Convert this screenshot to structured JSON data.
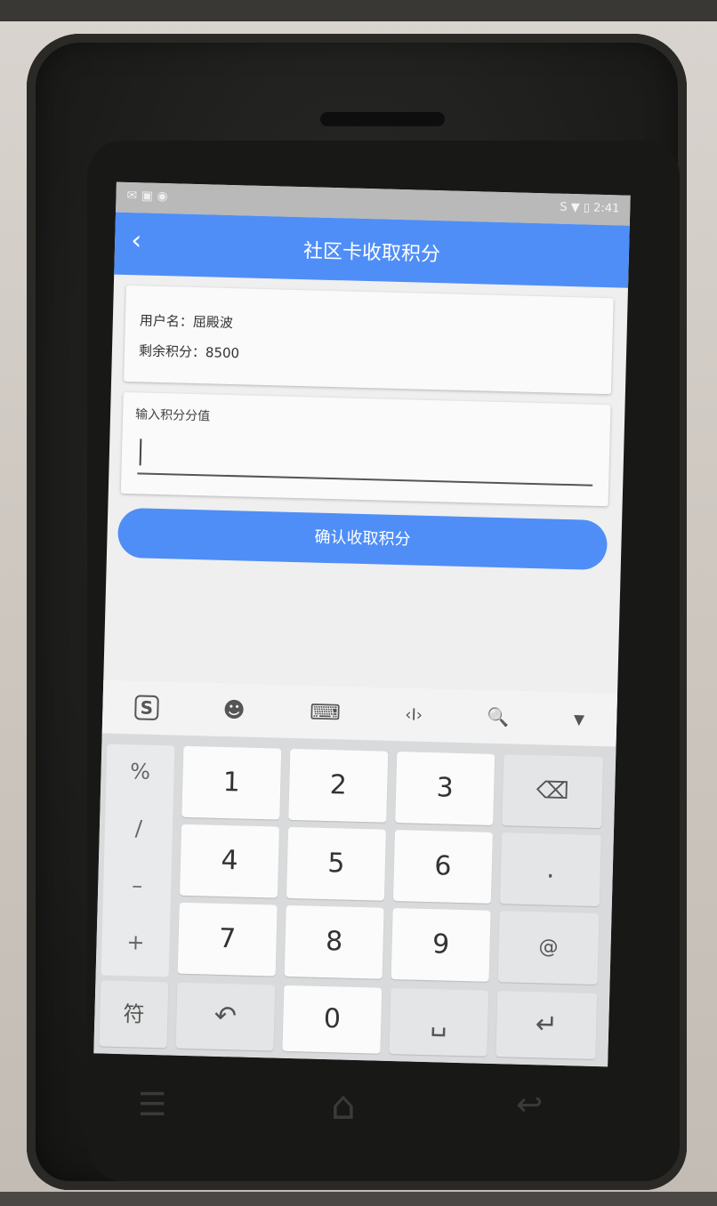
{
  "status_bar": {
    "left_icons": "✉ ▣ ◉",
    "right_icons": "S ▼ ▯",
    "time": "2:41"
  },
  "app_bar": {
    "back_icon": "‹",
    "title": "社区卡收取积分"
  },
  "user_card": {
    "username_line": "用户名：屈殿波",
    "points_line": "剩余积分：8500"
  },
  "input_card": {
    "label": "输入积分分值",
    "value": ""
  },
  "confirm_button": {
    "label": "确认收取积分"
  },
  "keyboard": {
    "toolbar": {
      "sogou_icon": "S",
      "emoji_icon": "☻",
      "keyboard_icon": "⌨",
      "cursor_icon": "‹I›",
      "search_icon": "🔍",
      "collapse_icon": "▾"
    },
    "symbols": [
      "%",
      "/",
      "–",
      "+"
    ],
    "digits": [
      "1",
      "2",
      "3",
      "4",
      "5",
      "6",
      "7",
      "8",
      "9",
      "0"
    ],
    "backspace_label": "⌫",
    "dot_label": ".",
    "at_label": "@",
    "symbol_key": "符",
    "undo_key": "↶",
    "space_key": "␣",
    "enter_key": "↵"
  },
  "nav_bar": {
    "menu_icon": "☰",
    "home_icon": "⌂",
    "back_icon": "↩"
  }
}
